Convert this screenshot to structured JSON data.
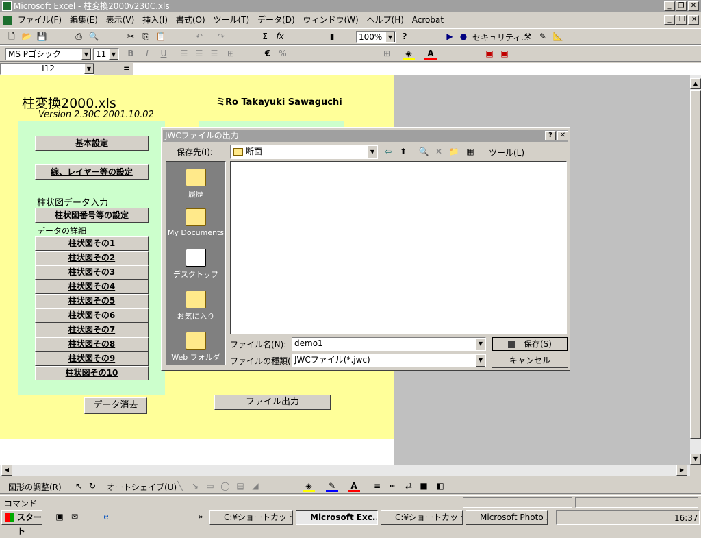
{
  "window": {
    "title": "Microsoft Excel - 柱変換2000v230C.xls",
    "min": "_",
    "max": "❐",
    "close": "✕"
  },
  "menu": [
    "ファイル(F)",
    "編集(E)",
    "表示(V)",
    "挿入(I)",
    "書式(O)",
    "ツール(T)",
    "データ(D)",
    "ウィンドウ(W)",
    "ヘルプ(H)",
    "Acrobat"
  ],
  "toolbar1": {
    "zoom": "100%",
    "help": "?",
    "security": "セキュリティ..."
  },
  "toolbar2": {
    "font": "MS Pゴシック",
    "size": "11",
    "bold": "B",
    "italic": "I",
    "underline": "U",
    "currency": "€",
    "percent": "%"
  },
  "formula": {
    "namebox": "I12",
    "equals": "="
  },
  "sheet": {
    "title": "柱変換2000.xls",
    "version": "Version 2.30C  2001.10.02",
    "author": "ミRo  Takayuki Sawaguchi",
    "btn_basic": "基本設定",
    "btn_layer": "線、レイヤー等の設定",
    "section_input": "柱状図データ入力",
    "btn_number": "柱状図番号等の設定",
    "section_detail": "データの詳細",
    "items": [
      "柱状図その1",
      "柱状図その2",
      "柱状図その3",
      "柱状図その4",
      "柱状図その5",
      "柱状図その6",
      "柱状図その7",
      "柱状図その8",
      "柱状図その9",
      "柱状図その10"
    ],
    "btn_clear": "データ消去",
    "btn_output": "ファイル出力"
  },
  "dialog": {
    "title": "JWCファイルの出力",
    "help": "?",
    "close": "✕",
    "save_in_label": "保存先(I):",
    "save_in_value": "断面",
    "tools_label": "ツール(L)",
    "places": [
      "履歴",
      "My Documents",
      "デスクトップ",
      "お気に入り",
      "Web フォルダ"
    ],
    "filename_label": "ファイル名(N):",
    "filename_value": "demo1",
    "filetype_label": "ファイルの種類(T):",
    "filetype_value": "JWCファイル(*.jwc)",
    "save_btn": "保存(S)",
    "cancel_btn": "キャンセル"
  },
  "drawing": {
    "adjust": "図形の調整(R)",
    "autoshape": "オートシェイプ(U)"
  },
  "status": {
    "mode": "コマンド"
  },
  "taskbar": {
    "start": "スタート",
    "tasks": [
      "C:¥ショートカット集...",
      "Microsoft Exc...",
      "C:¥ショートカット集...",
      "Microsoft Photo ..."
    ],
    "clock": "16:37"
  }
}
